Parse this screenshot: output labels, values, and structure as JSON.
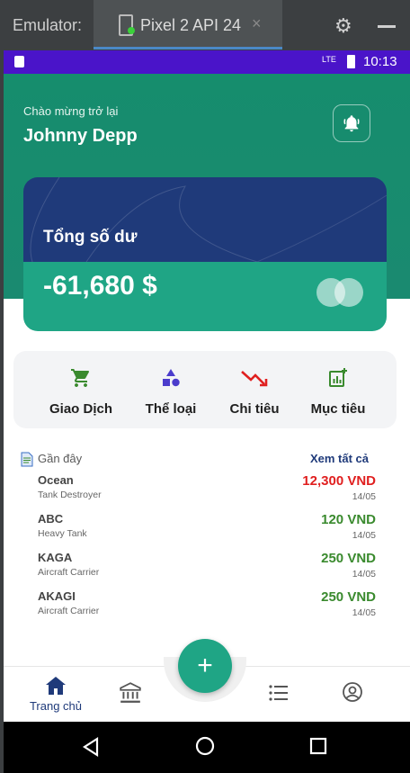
{
  "emulator": {
    "label": "Emulator:",
    "device_tab": "Pixel 2 API 24",
    "close_symbol": "×",
    "settings_icon": "gear-icon",
    "minimize_icon": "minimize-icon"
  },
  "status_bar": {
    "network": "LTE",
    "time": "10:13"
  },
  "header": {
    "greeting": "Chào mừng trở lại",
    "user_name": "Johnny Depp"
  },
  "balance_card": {
    "title": "Tổng số dư",
    "balance": "-61,680 $"
  },
  "actions": [
    {
      "label": "Giao Dịch",
      "icon": "cart-icon",
      "color": "#3a8a2e"
    },
    {
      "label": "Thể loại",
      "icon": "shapes-icon",
      "color": "#4b3ccc"
    },
    {
      "label": "Chi tiêu",
      "icon": "trending-down-icon",
      "color": "#e01f1f"
    },
    {
      "label": "Mục tiêu",
      "icon": "report-icon",
      "color": "#3a8a2e"
    }
  ],
  "recent": {
    "title": "Gần đây",
    "see_all": "Xem tất cả",
    "transactions": [
      {
        "name": "Ocean",
        "category": "Tank Destroyer",
        "amount": "12,300 VND",
        "date": "14/05",
        "color": "#e01f1f"
      },
      {
        "name": "ABC",
        "category": "Heavy Tank",
        "amount": "120 VND",
        "date": "14/05",
        "color": "#3a8a2e"
      },
      {
        "name": "KAGA",
        "category": "Aircraft Carrier",
        "amount": "250 VND",
        "date": "14/05",
        "color": "#3a8a2e"
      },
      {
        "name": "AKAGI",
        "category": "Aircraft Carrier",
        "amount": "250 VND",
        "date": "14/05",
        "color": "#3a8a2e"
      }
    ]
  },
  "bottom_nav": {
    "home_label": "Trang chủ",
    "fab_symbol": "+"
  },
  "colors": {
    "primary_green": "#1fa585",
    "header_green": "#168d6d",
    "card_blue": "#1f3a7a",
    "status_purple": "#4a14c9"
  }
}
